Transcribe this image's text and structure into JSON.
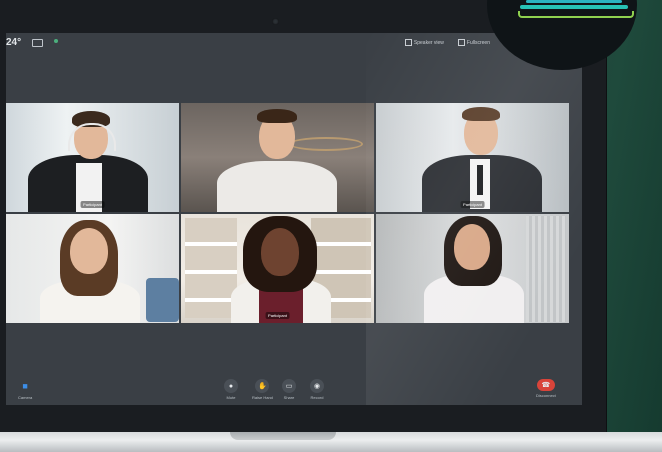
{
  "topbar": {
    "time": "24°",
    "status_text": "",
    "speaker_view_label": "Speaker view",
    "fullscreen_label": "Fullscreen"
  },
  "participants": [
    {
      "name": "Participant",
      "tile": "t1"
    },
    {
      "name": "",
      "tile": "t2"
    },
    {
      "name": "Participant",
      "tile": "t3"
    },
    {
      "name": "",
      "tile": "t4"
    },
    {
      "name": "Participant",
      "tile": "t5"
    },
    {
      "name": "",
      "tile": "t6"
    }
  ],
  "controls": {
    "camera_label": "Camera",
    "mute_label": "Mute",
    "raise_hand_label": "Raise Hand",
    "share_label": "Share",
    "record_label": "Record",
    "disconnect_label": "Disconnect"
  },
  "colors": {
    "accent_blue": "#3c8ee8",
    "end_call_red": "#d9443a",
    "logo_green": "#8fd14f",
    "logo_teal": "#2bb3c0"
  }
}
